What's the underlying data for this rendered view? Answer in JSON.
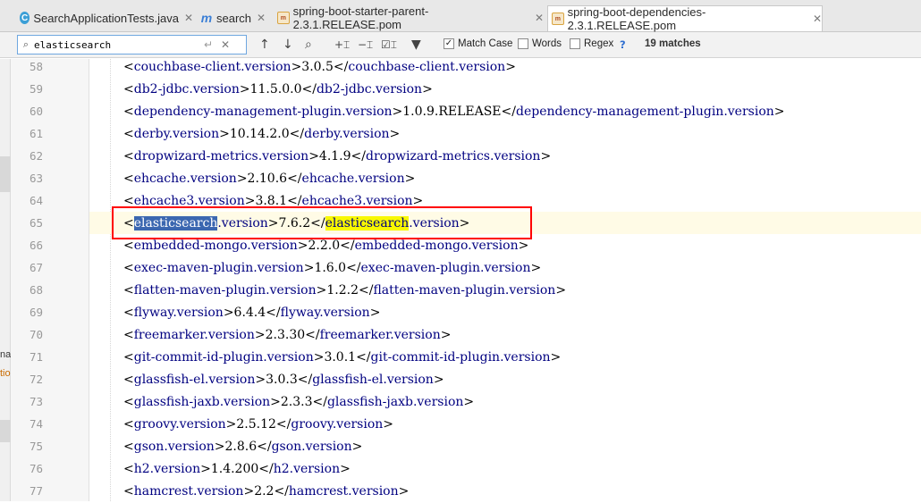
{
  "tabs": [
    {
      "label": "SearchApplicationTests.java",
      "icon": "java-class-icon",
      "active": false
    },
    {
      "label": "search",
      "icon": "maven-module-icon",
      "active": false
    },
    {
      "label": "spring-boot-starter-parent-2.3.1.RELEASE.pom",
      "icon": "pom-file-icon",
      "active": false
    },
    {
      "label": "spring-boot-dependencies-2.3.1.RELEASE.pom",
      "icon": "pom-file-icon",
      "active": true
    }
  ],
  "search": {
    "query": "elasticsearch",
    "options": {
      "match_case": {
        "label": "Match Case",
        "checked": true
      },
      "words": {
        "label": "Words",
        "checked": false
      },
      "regex": {
        "label": "Regex",
        "checked": false
      }
    },
    "help": "?",
    "match_count": "19 matches"
  },
  "side_panel": {
    "label_top": "nal",
    "label_bottom": "tio"
  },
  "editor": {
    "current_line": 65,
    "lines": [
      {
        "num": "58",
        "tag": "couchbase-client.version",
        "value": "3.0.5"
      },
      {
        "num": "59",
        "tag": "db2-jdbc.version",
        "value": "11.5.0.0"
      },
      {
        "num": "60",
        "tag": "dependency-management-plugin.version",
        "value": "1.0.9.RELEASE"
      },
      {
        "num": "61",
        "tag": "derby.version",
        "value": "10.14.2.0"
      },
      {
        "num": "62",
        "tag": "dropwizard-metrics.version",
        "value": "4.1.9"
      },
      {
        "num": "63",
        "tag": "ehcache.version",
        "value": "2.10.6"
      },
      {
        "num": "64",
        "tag": "ehcache3.version",
        "value": "3.8.1"
      },
      {
        "num": "65",
        "tag_match": "elasticsearch",
        "tag_rest": ".version",
        "value": "7.6.2"
      },
      {
        "num": "66",
        "tag": "embedded-mongo.version",
        "value": "2.2.0"
      },
      {
        "num": "67",
        "tag": "exec-maven-plugin.version",
        "value": "1.6.0"
      },
      {
        "num": "68",
        "tag": "flatten-maven-plugin.version",
        "value": "1.2.2"
      },
      {
        "num": "69",
        "tag": "flyway.version",
        "value": "6.4.4"
      },
      {
        "num": "70",
        "tag": "freemarker.version",
        "value": "2.3.30"
      },
      {
        "num": "71",
        "tag": "git-commit-id-plugin.version",
        "value": "3.0.1"
      },
      {
        "num": "72",
        "tag": "glassfish-el.version",
        "value": "3.0.3"
      },
      {
        "num": "73",
        "tag": "glassfish-jaxb.version",
        "value": "2.3.3"
      },
      {
        "num": "74",
        "tag": "groovy.version",
        "value": "2.5.12"
      },
      {
        "num": "75",
        "tag": "gson.version",
        "value": "2.8.6"
      },
      {
        "num": "76",
        "tag": "h2.version",
        "value": "1.4.200"
      },
      {
        "num": "77",
        "tag": "hamcrest.version",
        "value": "2.2"
      }
    ]
  }
}
